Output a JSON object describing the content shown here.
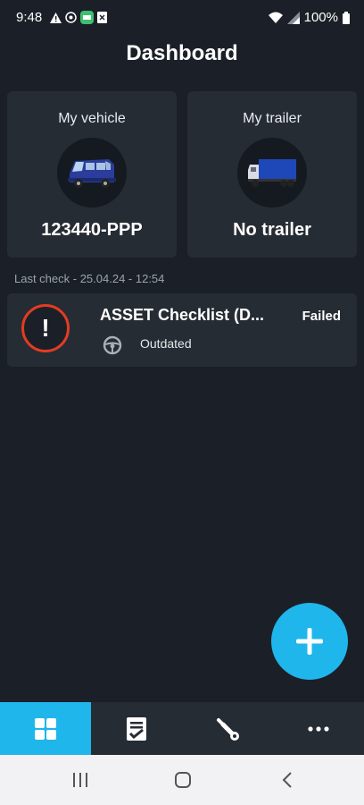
{
  "status_bar": {
    "time": "9:48",
    "battery": "100%",
    "left_icons": [
      "warning-icon",
      "target-icon",
      "app-icon",
      "image-icon"
    ],
    "right_icons": [
      "wifi-icon",
      "signal-icon",
      "battery-icon"
    ]
  },
  "page": {
    "title": "Dashboard"
  },
  "vehicle_card": {
    "label": "My vehicle",
    "value": "123440-PPP",
    "icon": "van-icon"
  },
  "trailer_card": {
    "label": "My trailer",
    "value": "No trailer",
    "icon": "truck-icon"
  },
  "last_check": "Last check - 25.04.24 - 12:54",
  "checklist": {
    "name": "ASSET Checklist (D...",
    "result": "Failed",
    "state": "Outdated",
    "alert_color": "#e33b23"
  },
  "fab": {
    "icon": "plus-icon"
  },
  "bottom_nav": [
    {
      "icon": "dashboard-icon",
      "active": true
    },
    {
      "icon": "checklist-icon",
      "active": false
    },
    {
      "icon": "wrench-icon",
      "active": false
    },
    {
      "icon": "more-icon",
      "active": false
    }
  ],
  "system_nav": [
    "recents-icon",
    "home-icon",
    "back-icon"
  ],
  "colors": {
    "accent": "#1fb6ec",
    "background": "#1b2028",
    "card": "#262c33",
    "error": "#e33b23"
  }
}
